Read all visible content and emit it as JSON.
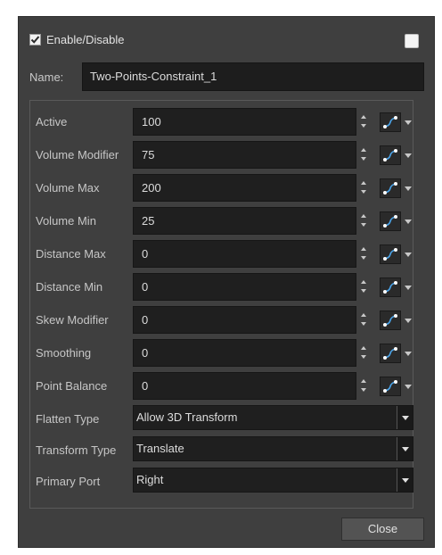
{
  "header": {
    "enable_label": "Enable/Disable",
    "enable_checked": true
  },
  "name": {
    "label": "Name:",
    "value": "Two-Points-Constraint_1"
  },
  "attributes": [
    {
      "label": "Active",
      "value": "100"
    },
    {
      "label": "Volume Modifier",
      "value": "75"
    },
    {
      "label": "Volume Max",
      "value": "200"
    },
    {
      "label": "Volume Min",
      "value": "25"
    },
    {
      "label": "Distance Max",
      "value": "0"
    },
    {
      "label": "Distance Min",
      "value": "0"
    },
    {
      "label": "Skew Modifier",
      "value": "0"
    },
    {
      "label": "Smoothing",
      "value": "0"
    },
    {
      "label": "Point Balance",
      "value": "0"
    }
  ],
  "dropdowns": [
    {
      "label": "Flatten Type",
      "value": "Allow 3D Transform"
    },
    {
      "label": "Transform Type",
      "value": "Translate"
    },
    {
      "label": "Primary Port",
      "value": "Right"
    }
  ],
  "footer": {
    "close_label": "Close"
  },
  "colors": {
    "panel": "#3f3f3f",
    "field": "#1f1f1f",
    "function_icon": "#4aa3e8"
  }
}
